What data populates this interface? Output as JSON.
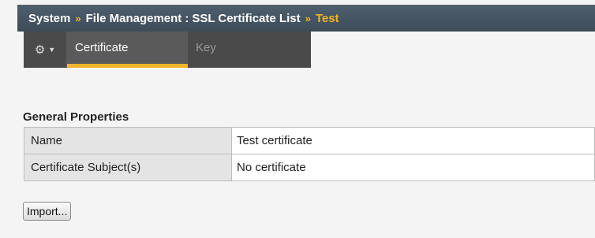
{
  "breadcrumb": {
    "items": [
      "System",
      "File Management",
      "SSL Certificate List"
    ],
    "current": "Test",
    "separator": "»",
    "colon": ":"
  },
  "tabs": {
    "menu_icon": "gear-icon",
    "items": [
      {
        "label": "Certificate",
        "active": true
      },
      {
        "label": "Key",
        "active": false
      }
    ]
  },
  "general_properties": {
    "title": "General Properties",
    "rows": [
      {
        "label": "Name",
        "value": "Test  certificate"
      },
      {
        "label": "Certificate Subject(s)",
        "value": "No certificate"
      }
    ]
  },
  "actions": {
    "import_label": "Import..."
  },
  "colors": {
    "header_bg": "#44525f",
    "accent": "#f0b428",
    "tabbar_bg": "#4a4a4a"
  }
}
